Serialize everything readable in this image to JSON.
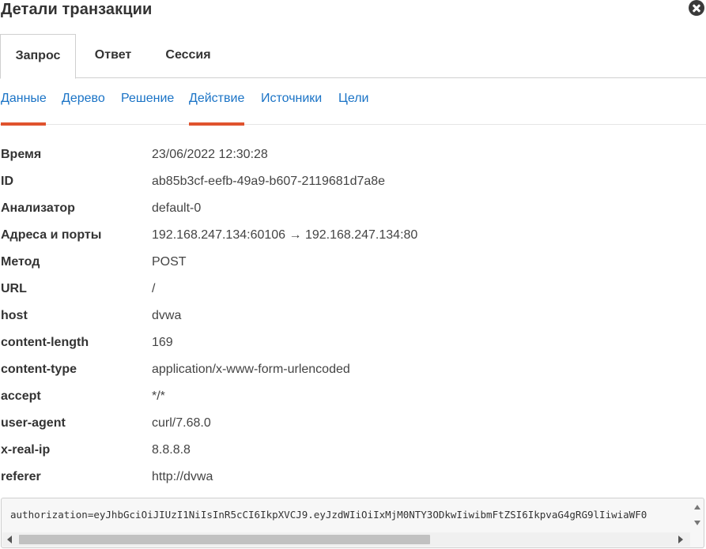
{
  "dialog": {
    "title": "Детали транзакции"
  },
  "main_tabs": [
    {
      "label": "Запрос",
      "active": true
    },
    {
      "label": "Ответ",
      "active": false
    },
    {
      "label": "Сессия",
      "active": false
    }
  ],
  "sub_tabs": [
    {
      "label": "Данные",
      "underlined": true
    },
    {
      "label": "Дерево",
      "underlined": false
    },
    {
      "label": "Решение",
      "underlined": false
    },
    {
      "label": "Действие",
      "underlined": true
    },
    {
      "label": "Источники",
      "underlined": false
    },
    {
      "label": "Цели",
      "underlined": false
    }
  ],
  "fields": [
    {
      "key": "Время",
      "value": "23/06/2022 12:30:28"
    },
    {
      "key": "ID",
      "value": "ab85b3cf-eefb-49a9-b607-2119681d7a8e"
    },
    {
      "key": "Анализатор",
      "value": "default-0"
    },
    {
      "key": "Адреса и порты",
      "value": "192.168.247.134:60106 → 192.168.247.134:80"
    },
    {
      "key": "Метод",
      "value": "POST"
    },
    {
      "key": "URL",
      "value": "/"
    },
    {
      "key": "host",
      "value": "dvwa"
    },
    {
      "key": "content-length",
      "value": "169"
    },
    {
      "key": "content-type",
      "value": "application/x-www-form-urlencoded"
    },
    {
      "key": "accept",
      "value": "*/*"
    },
    {
      "key": "user-agent",
      "value": "curl/7.68.0"
    },
    {
      "key": "x-real-ip",
      "value": "8.8.8.8"
    },
    {
      "key": "referer",
      "value": "http://dvwa"
    }
  ],
  "body_preview": "authorization=eyJhbGciOiJIUzI1NiIsInR5cCI6IkpXVCJ9.eyJzdWIiOiIxMjM0NTY3ODkwIiwibmFtZSI6IkpvaG4gRG9lIiwiaWF0",
  "colors": {
    "link": "#1a73c6",
    "accent_underline": "#e0532e"
  }
}
